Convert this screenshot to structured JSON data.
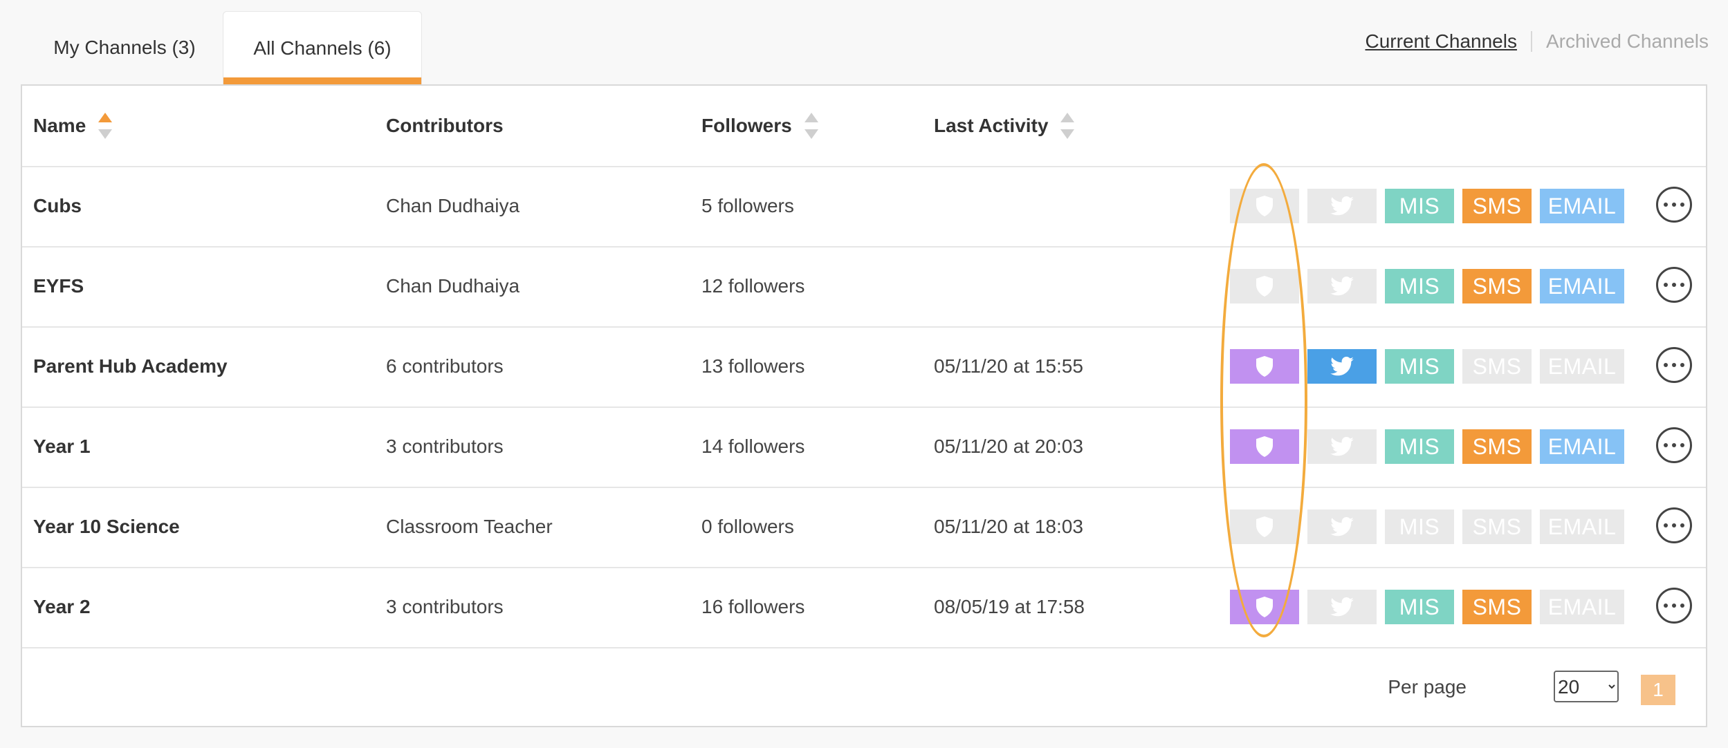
{
  "tabs": [
    {
      "label": "My Channels (3)",
      "active": false
    },
    {
      "label": "All Channels (6)",
      "active": true
    }
  ],
  "links": {
    "current": "Current Channels",
    "archived": "Archived Channels"
  },
  "columns": {
    "name": "Name",
    "contributors": "Contributors",
    "followers": "Followers",
    "last_activity": "Last Activity"
  },
  "colors": {
    "accent": "#f39a3a",
    "shield_on": "#c191f0",
    "twitter_on": "#4aa0e6",
    "mis_on": "#7fd4c4",
    "sms_on": "#f39a3a",
    "email_on": "#86c2f5",
    "badge_off": "#e9e9e9"
  },
  "badge_labels": {
    "mis": "MIS",
    "sms": "SMS",
    "email": "EMAIL"
  },
  "icons": {
    "shield": "shield-icon",
    "twitter": "twitter-icon",
    "more": "more-options-icon"
  },
  "rows": [
    {
      "name": "Cubs",
      "contributors": "Chan Dudhaiya",
      "followers": "5 followers",
      "last_activity": "",
      "shield": false,
      "twitter": false,
      "mis": true,
      "sms": true,
      "email": true
    },
    {
      "name": "EYFS",
      "contributors": "Chan Dudhaiya",
      "followers": "12 followers",
      "last_activity": "",
      "shield": false,
      "twitter": false,
      "mis": true,
      "sms": true,
      "email": true
    },
    {
      "name": "Parent Hub Academy",
      "contributors": "6 contributors",
      "followers": "13 followers",
      "last_activity": "05/11/20 at 15:55",
      "shield": true,
      "twitter": true,
      "mis": true,
      "sms": false,
      "email": false
    },
    {
      "name": "Year 1",
      "contributors": "3 contributors",
      "followers": "14 followers",
      "last_activity": "05/11/20 at 20:03",
      "shield": true,
      "twitter": false,
      "mis": true,
      "sms": true,
      "email": true
    },
    {
      "name": "Year 10 Science",
      "contributors": "Classroom Teacher",
      "followers": "0 followers",
      "last_activity": "05/11/20 at 18:03",
      "shield": false,
      "twitter": false,
      "mis": false,
      "sms": false,
      "email": false
    },
    {
      "name": "Year 2",
      "contributors": "3 contributors",
      "followers": "16 followers",
      "last_activity": "08/05/19 at 17:58",
      "shield": true,
      "twitter": false,
      "mis": true,
      "sms": true,
      "email": false
    }
  ],
  "pagination": {
    "per_page_label": "Per page",
    "per_page_value": "20",
    "current_page": "1"
  }
}
